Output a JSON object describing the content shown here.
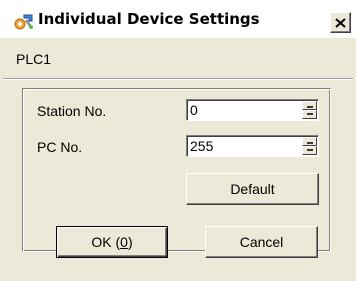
{
  "window": {
    "title": "Individual Device Settings",
    "icon": "settings-wrench-icon",
    "close_icon": "close-icon"
  },
  "device": {
    "name": "PLC1"
  },
  "fields": {
    "station": {
      "label": "Station No.",
      "value": "0"
    },
    "pc": {
      "label": "PC No.",
      "value": "255"
    }
  },
  "buttons": {
    "default_label": "Default",
    "ok_label_prefix": "OK (",
    "ok_label_accel": "0",
    "ok_label_suffix": ")",
    "cancel_label": "Cancel"
  },
  "colors": {
    "dialog_bg": "#ece9d8",
    "title_bg": "#ffffff"
  }
}
